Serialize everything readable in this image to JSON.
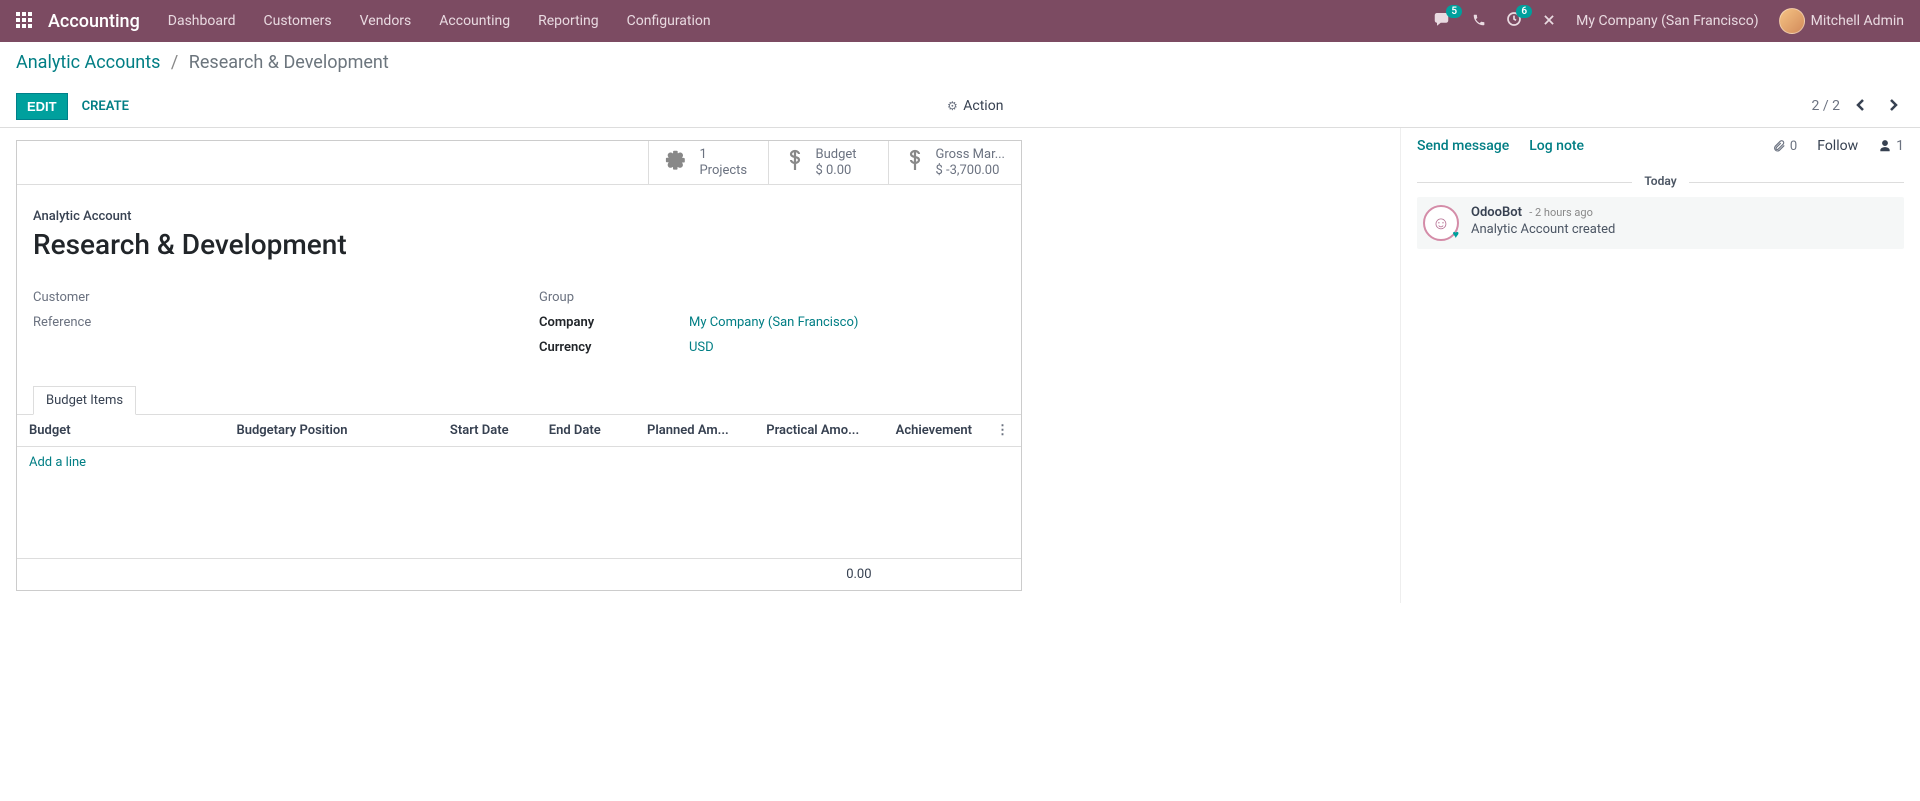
{
  "navbar": {
    "app_name": "Accounting",
    "menu": [
      "Dashboard",
      "Customers",
      "Vendors",
      "Accounting",
      "Reporting",
      "Configuration"
    ],
    "msg_badge": "5",
    "clock_badge": "6",
    "company": "My Company (San Francisco)",
    "user": "Mitchell Admin"
  },
  "breadcrumb": {
    "parent": "Analytic Accounts",
    "current": "Research & Development"
  },
  "buttons": {
    "edit": "Edit",
    "create": "Create",
    "action": "Action"
  },
  "pager": {
    "text": "2 / 2"
  },
  "stats": {
    "projects": {
      "count": "1",
      "label": "Projects"
    },
    "budget": {
      "label": "Budget",
      "value": "$ 0.00"
    },
    "gross": {
      "label": "Gross Mar...",
      "value": "$ -3,700.00"
    }
  },
  "record": {
    "label": "Analytic Account",
    "title": "Research & Development",
    "customer_label": "Customer",
    "reference_label": "Reference",
    "group_label": "Group",
    "company_label": "Company",
    "company_value": "My Company (San Francisco)",
    "currency_label": "Currency",
    "currency_value": "USD"
  },
  "tabs": {
    "budget_items": "Budget Items"
  },
  "table": {
    "headers": {
      "budget": "Budget",
      "position": "Budgetary Position",
      "start": "Start Date",
      "end": "End Date",
      "planned": "Planned Am...",
      "practical": "Practical Amo...",
      "achievement": "Achievement"
    },
    "add_line": "Add a line",
    "footer_total": "0.00"
  },
  "chatter": {
    "send": "Send message",
    "log": "Log note",
    "attach_count": "0",
    "follow": "Follow",
    "follower_count": "1",
    "today": "Today",
    "msg": {
      "author": "OdooBot",
      "time": "- 2 hours ago",
      "text": "Analytic Account created"
    }
  }
}
